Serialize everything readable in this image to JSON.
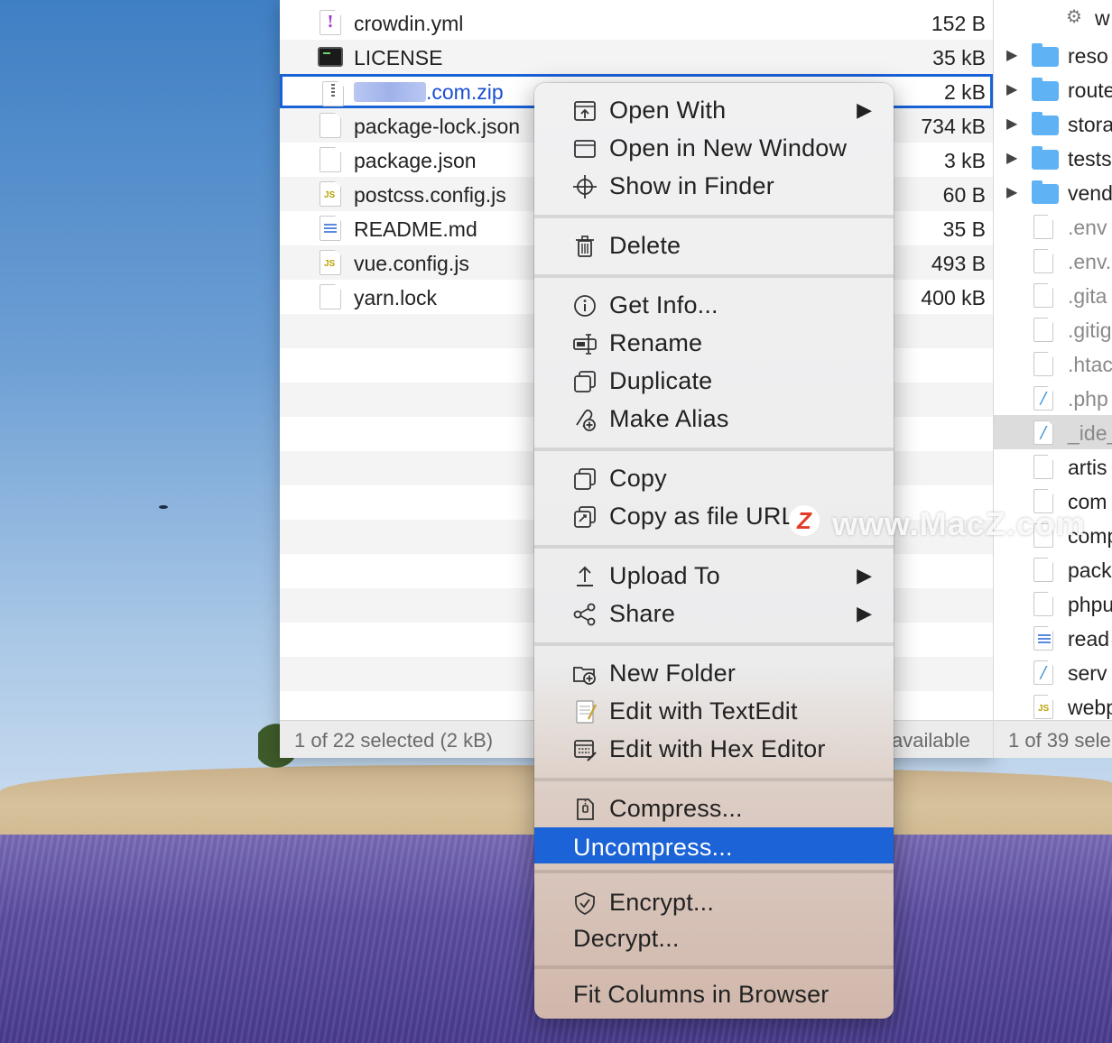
{
  "finder_left": {
    "files": [
      {
        "name": "crowdin.yml",
        "size": "152 B",
        "icon": "warning-doc-icon"
      },
      {
        "name": "LICENSE",
        "size": "35 kB",
        "icon": "terminal-doc-icon"
      },
      {
        "name": ".com.zip",
        "size": "2 kB",
        "icon": "zip-doc-icon",
        "selected": true
      },
      {
        "name": "package-lock.json",
        "size": "734 kB",
        "icon": "document-icon"
      },
      {
        "name": "package.json",
        "size": "3 kB",
        "icon": "document-icon"
      },
      {
        "name": "postcss.config.js",
        "size": "60 B",
        "icon": "js-doc-icon"
      },
      {
        "name": "README.md",
        "size": "35 B",
        "icon": "markdown-doc-icon"
      },
      {
        "name": "vue.config.js",
        "size": "493 B",
        "icon": "js-doc-icon"
      },
      {
        "name": "yarn.lock",
        "size": "400 kB",
        "icon": "document-icon"
      }
    ],
    "status_left": "1 of 22 selected (2 kB)",
    "status_right": "available"
  },
  "finder_right": {
    "items": [
      {
        "name": "w",
        "kind": "gear"
      },
      {
        "name": "reso",
        "kind": "folder"
      },
      {
        "name": "route",
        "kind": "folder"
      },
      {
        "name": "stora",
        "kind": "folder"
      },
      {
        "name": "tests",
        "kind": "folder"
      },
      {
        "name": "vend",
        "kind": "folder"
      },
      {
        "name": ".env",
        "kind": "doc",
        "dim": true
      },
      {
        "name": ".env.",
        "kind": "doc",
        "dim": true
      },
      {
        "name": ".gita",
        "kind": "doc",
        "dim": true
      },
      {
        "name": ".gitig",
        "kind": "doc",
        "dim": true
      },
      {
        "name": ".htac",
        "kind": "doc",
        "dim": true
      },
      {
        "name": ".php",
        "kind": "php",
        "dim": true
      },
      {
        "name": "_ide_",
        "kind": "php",
        "dim": true,
        "highlight": true
      },
      {
        "name": "artis",
        "kind": "doc"
      },
      {
        "name": "com",
        "kind": "doc"
      },
      {
        "name": "comp",
        "kind": "doc"
      },
      {
        "name": "pack",
        "kind": "doc"
      },
      {
        "name": "phpu",
        "kind": "doc"
      },
      {
        "name": "read",
        "kind": "md"
      },
      {
        "name": "serv",
        "kind": "php"
      },
      {
        "name": "webp",
        "kind": "js"
      }
    ],
    "status": "1 of 39 sele"
  },
  "context_menu": {
    "open_with": "Open With",
    "open_new_window": "Open in New Window",
    "show_in_finder": "Show in Finder",
    "delete": "Delete",
    "get_info": "Get Info...",
    "rename": "Rename",
    "duplicate": "Duplicate",
    "make_alias": "Make Alias",
    "copy": "Copy",
    "copy_url": "Copy as file URL",
    "upload_to": "Upload To",
    "share": "Share",
    "new_folder": "New Folder",
    "edit_textedit": "Edit with TextEdit",
    "edit_hex": "Edit with Hex Editor",
    "compress": "Compress...",
    "uncompress": "Uncompress...",
    "encrypt": "Encrypt...",
    "decrypt": "Decrypt...",
    "fit_columns": "Fit Columns in Browser",
    "submenu_arrow": "▶"
  },
  "watermark": {
    "logo": "Z",
    "text": "www.MacZ.com"
  },
  "colors": {
    "selection_blue": "#1b63d6",
    "folder_blue": "#5fb3f5",
    "menu_bg": "#f1f1f2"
  }
}
